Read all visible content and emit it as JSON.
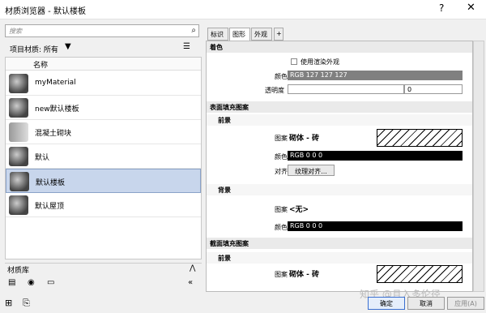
{
  "window": {
    "title": "材质浏览器 - 默认楼板",
    "help_label": "?",
    "close_label": "✕"
  },
  "search": {
    "placeholder": "搜索",
    "icon": "search-icon"
  },
  "library_header": {
    "label": "项目材质: 所有",
    "filter_icon": "▼",
    "view_icon": "☰"
  },
  "list": {
    "column": "名称",
    "items": [
      {
        "name": "myMaterial"
      },
      {
        "name": "new默认楼板"
      },
      {
        "name": "混凝土砌块"
      },
      {
        "name": "默认"
      },
      {
        "name": "默认楼板",
        "selected": true
      },
      {
        "name": "默认屋顶"
      }
    ]
  },
  "library_bar": {
    "label": "材质库",
    "collapse": "⋀"
  },
  "tabs": [
    {
      "label": "标识"
    },
    {
      "label": "图形",
      "active": true
    },
    {
      "label": "外观"
    },
    {
      "label": "+"
    }
  ],
  "shading": {
    "header": "着色",
    "use_render": "使用渲染外观",
    "color_label": "颜色",
    "color_value": "RGB 127 127 127",
    "transparency_label": "透明度",
    "transparency_value": "0"
  },
  "surface": {
    "header": "表面填充图案",
    "fg_header": "前景",
    "pattern_label": "图案",
    "pattern_value": "砌体 - 砖",
    "color_label": "颜色",
    "color_value": "RGB 0 0 0",
    "align_label": "对齐",
    "align_button": "纹理对齐...",
    "bg_header": "背景",
    "bg_pattern_value": "<无>",
    "bg_color_value": "RGB 0 0 0"
  },
  "cut": {
    "header": "截面填充图案",
    "fg_header": "前景",
    "pattern_label": "图案",
    "pattern_value": "砌体 - 砖"
  },
  "footer": {
    "ok": "确定",
    "cancel": "取消",
    "apply": "应用(A)"
  },
  "watermark": "知乎 @且入多伦径"
}
